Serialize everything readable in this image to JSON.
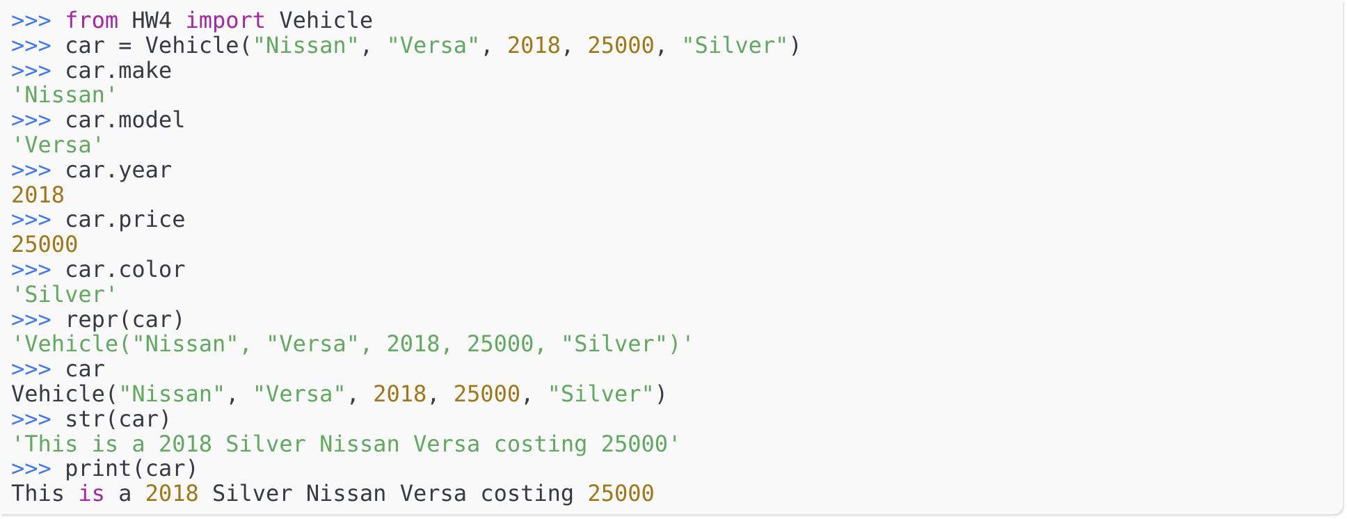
{
  "colors": {
    "background": "#f9f9f9",
    "prompt": "#4078f2",
    "keyword": "#a626a4",
    "string": "#50a14f",
    "number": "#986801",
    "text": "#383a42"
  },
  "console": {
    "prompt": ">>> ",
    "lines": [
      {
        "type": "input",
        "tokens": [
          {
            "t": "kw",
            "v": "from"
          },
          {
            "t": "plain",
            "v": " HW4 "
          },
          {
            "t": "kw",
            "v": "import"
          },
          {
            "t": "plain",
            "v": " Vehicle"
          }
        ]
      },
      {
        "type": "input",
        "tokens": [
          {
            "t": "plain",
            "v": "car = Vehicle("
          },
          {
            "t": "str",
            "v": "\"Nissan\""
          },
          {
            "t": "plain",
            "v": ", "
          },
          {
            "t": "str",
            "v": "\"Versa\""
          },
          {
            "t": "plain",
            "v": ", "
          },
          {
            "t": "num",
            "v": "2018"
          },
          {
            "t": "plain",
            "v": ", "
          },
          {
            "t": "num",
            "v": "25000"
          },
          {
            "t": "plain",
            "v": ", "
          },
          {
            "t": "str",
            "v": "\"Silver\""
          },
          {
            "t": "plain",
            "v": ")"
          }
        ]
      },
      {
        "type": "input",
        "tokens": [
          {
            "t": "plain",
            "v": "car.make"
          }
        ]
      },
      {
        "type": "output",
        "tokens": [
          {
            "t": "str",
            "v": "'Nissan'"
          }
        ]
      },
      {
        "type": "input",
        "tokens": [
          {
            "t": "plain",
            "v": "car.model"
          }
        ]
      },
      {
        "type": "output",
        "tokens": [
          {
            "t": "str",
            "v": "'Versa'"
          }
        ]
      },
      {
        "type": "input",
        "tokens": [
          {
            "t": "plain",
            "v": "car.year"
          }
        ]
      },
      {
        "type": "output",
        "tokens": [
          {
            "t": "num",
            "v": "2018"
          }
        ]
      },
      {
        "type": "input",
        "tokens": [
          {
            "t": "plain",
            "v": "car.price"
          }
        ]
      },
      {
        "type": "output",
        "tokens": [
          {
            "t": "num",
            "v": "25000"
          }
        ]
      },
      {
        "type": "input",
        "tokens": [
          {
            "t": "plain",
            "v": "car.color"
          }
        ]
      },
      {
        "type": "output",
        "tokens": [
          {
            "t": "str",
            "v": "'Silver'"
          }
        ]
      },
      {
        "type": "input",
        "tokens": [
          {
            "t": "plain",
            "v": "repr(car)"
          }
        ]
      },
      {
        "type": "output",
        "tokens": [
          {
            "t": "str",
            "v": "'Vehicle(\"Nissan\", \"Versa\", 2018, 25000, \"Silver\")'"
          }
        ]
      },
      {
        "type": "input",
        "tokens": [
          {
            "t": "plain",
            "v": "car"
          }
        ]
      },
      {
        "type": "output",
        "tokens": [
          {
            "t": "plain",
            "v": "Vehicle("
          },
          {
            "t": "str",
            "v": "\"Nissan\""
          },
          {
            "t": "plain",
            "v": ", "
          },
          {
            "t": "str",
            "v": "\"Versa\""
          },
          {
            "t": "plain",
            "v": ", "
          },
          {
            "t": "num",
            "v": "2018"
          },
          {
            "t": "plain",
            "v": ", "
          },
          {
            "t": "num",
            "v": "25000"
          },
          {
            "t": "plain",
            "v": ", "
          },
          {
            "t": "str",
            "v": "\"Silver\""
          },
          {
            "t": "plain",
            "v": ")"
          }
        ]
      },
      {
        "type": "input",
        "tokens": [
          {
            "t": "plain",
            "v": "str(car)"
          }
        ]
      },
      {
        "type": "output",
        "tokens": [
          {
            "t": "str",
            "v": "'This is a 2018 Silver Nissan Versa costing 25000'"
          }
        ]
      },
      {
        "type": "input",
        "tokens": [
          {
            "t": "plain",
            "v": "print(car)"
          }
        ]
      },
      {
        "type": "output",
        "tokens": [
          {
            "t": "plain",
            "v": "This "
          },
          {
            "t": "kw",
            "v": "is"
          },
          {
            "t": "plain",
            "v": " a "
          },
          {
            "t": "num",
            "v": "2018"
          },
          {
            "t": "plain",
            "v": " Silver Nissan Versa costing "
          },
          {
            "t": "num",
            "v": "25000"
          }
        ]
      }
    ]
  }
}
